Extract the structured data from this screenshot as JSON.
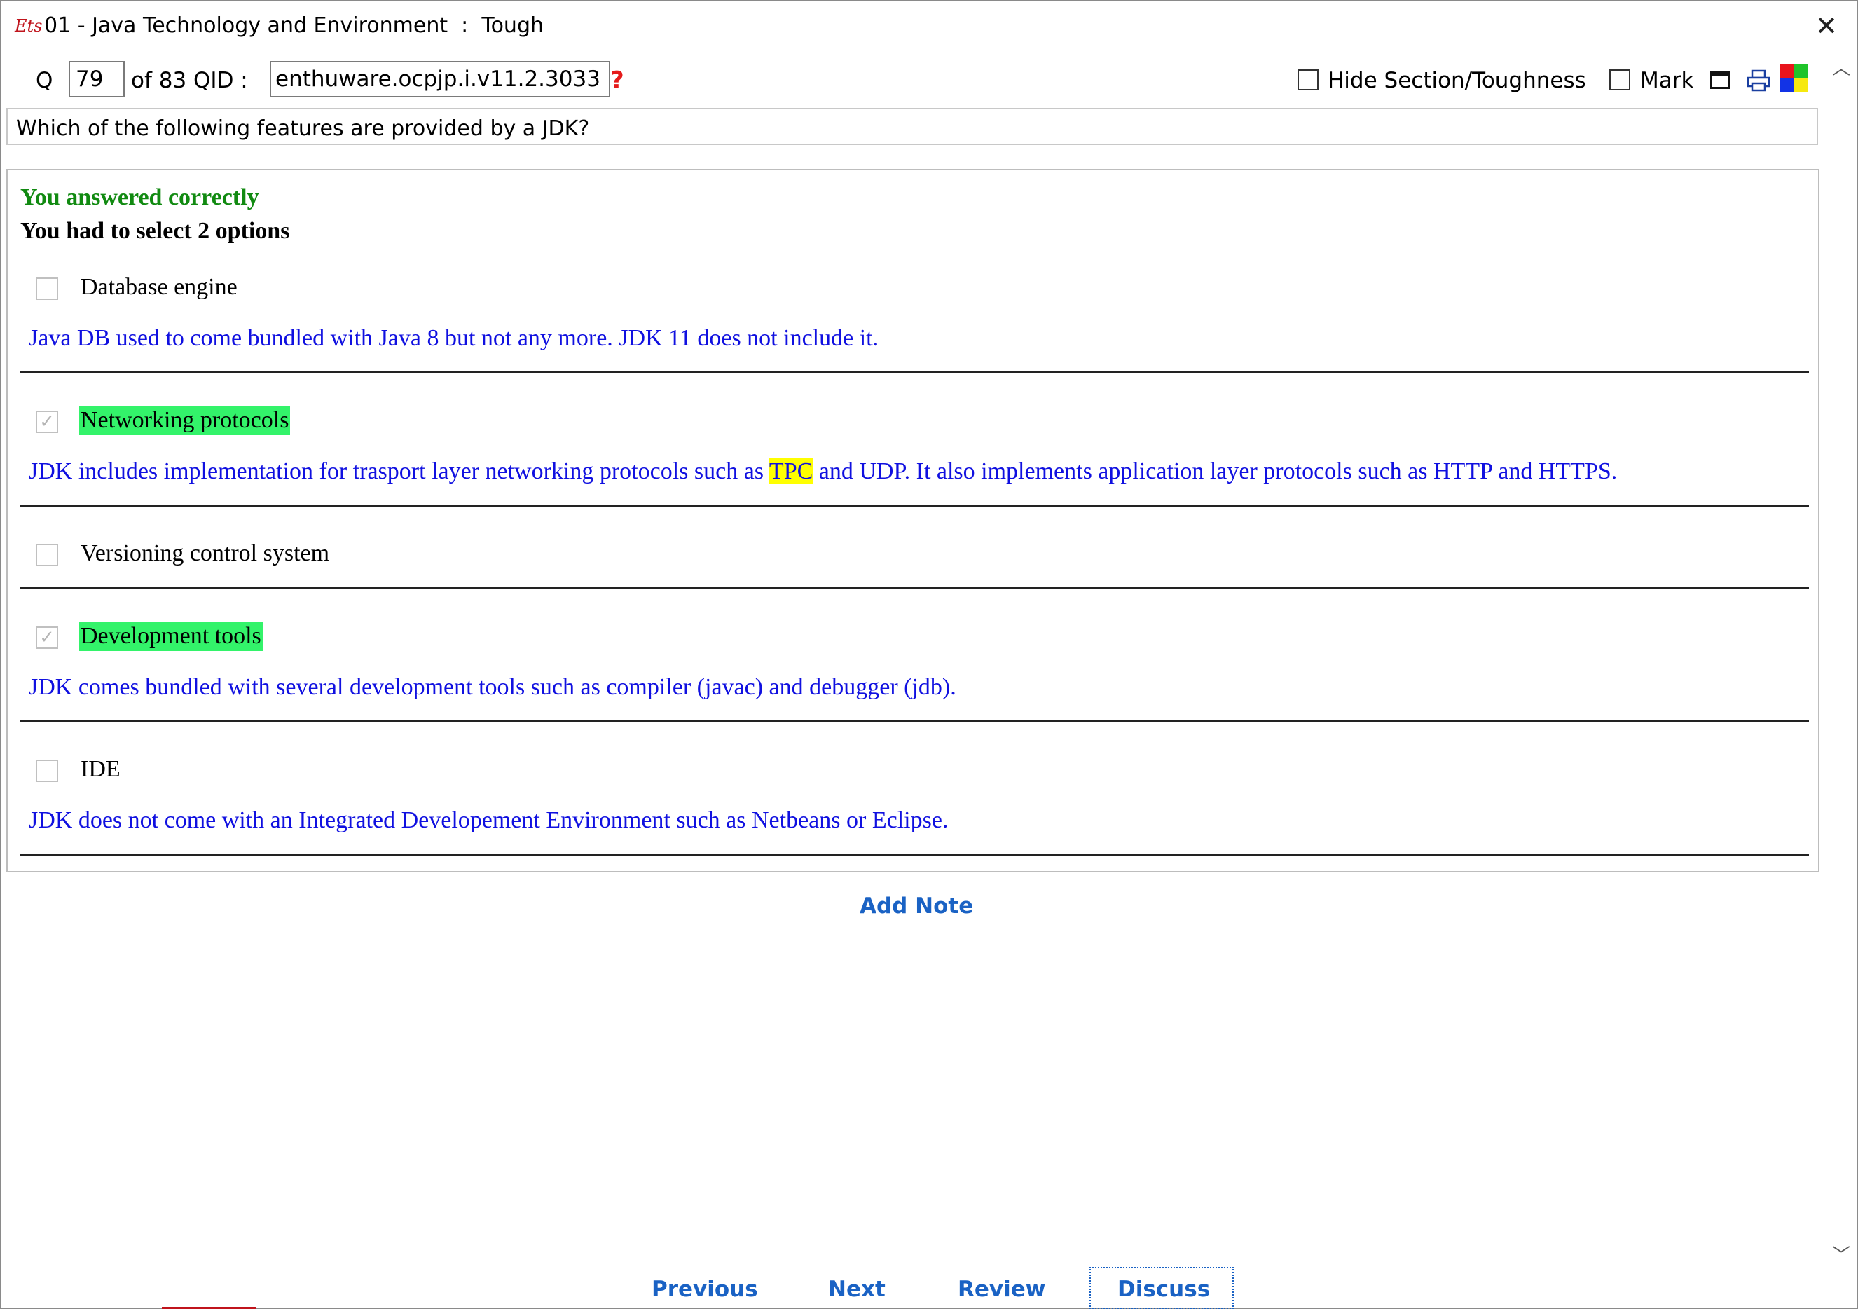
{
  "window": {
    "logo_text": "Ets",
    "title": "01 - Java Technology and Environment  :  Tough",
    "close_glyph": "✕"
  },
  "toolbar": {
    "q_label": "Q",
    "q_number": "79",
    "of_label": "of 83 QID :",
    "qid": "enthuware.ocpjp.i.v11.2.3033",
    "help_glyph": "?",
    "hide_label": "Hide Section/Toughness",
    "mark_label": "Mark"
  },
  "question": {
    "text": "Which of the following features are provided by a JDK?"
  },
  "answer": {
    "result": "You answered correctly",
    "instruction": "You had to select 2 options",
    "options": [
      {
        "label": "Database engine",
        "selected": false,
        "correct": false,
        "explanation": "Java DB used to come bundled with Java 8 but not any more. JDK 11 does not include it."
      },
      {
        "label": "Networking protocols",
        "selected": true,
        "correct": true,
        "explanation_before": "JDK includes implementation for trasport layer networking protocols such as ",
        "explanation_highlight": "TPC",
        "explanation_after": " and UDP. It also implements application layer protocols such as HTTP and HTTPS."
      },
      {
        "label": "Versioning control system",
        "selected": false,
        "correct": false,
        "explanation": ""
      },
      {
        "label": "Development tools",
        "selected": true,
        "correct": true,
        "explanation": "JDK comes bundled with several development tools such as compiler (javac) and debugger (jdb)."
      },
      {
        "label": "IDE",
        "selected": false,
        "correct": false,
        "explanation": "JDK does not come with an Integrated Developement Environment such as Netbeans or Eclipse."
      }
    ]
  },
  "actions": {
    "add_note": "Add Note",
    "previous": "Previous",
    "next": "Next",
    "review": "Review",
    "discuss": "Discuss"
  },
  "colors": {
    "correct_text": "#118a11",
    "explanation_text": "#1010e0",
    "correct_highlight": "#33f36a",
    "term_highlight": "#ffff00",
    "link": "#1a62c4"
  },
  "icons": {
    "title_logo": "ets-logo-icon",
    "close": "close-icon",
    "help": "help-icon",
    "window": "window-icon",
    "print": "print-icon",
    "colors": "color-palette-icon",
    "check": "checkmark-icon"
  }
}
